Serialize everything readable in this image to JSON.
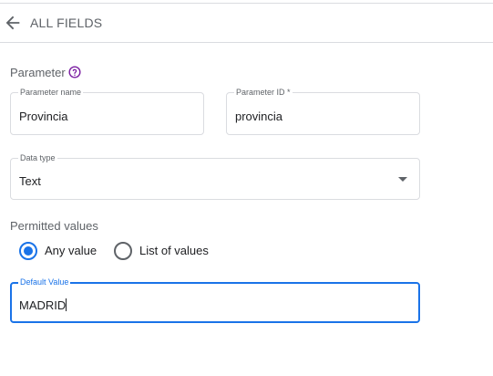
{
  "header": {
    "title": "ALL FIELDS",
    "back_icon": "arrow-left-icon"
  },
  "parameter": {
    "label": "Parameter",
    "help_icon": "help-circle-icon",
    "name_field": {
      "label": "Parameter name",
      "value": "Provincia"
    },
    "id_field": {
      "label": "Parameter ID *",
      "value": "provincia"
    },
    "data_type": {
      "label": "Data type",
      "value": "Text"
    }
  },
  "permitted": {
    "label": "Permitted values",
    "options": [
      {
        "label": "Any value",
        "selected": true
      },
      {
        "label": "List of values",
        "selected": false
      }
    ]
  },
  "default_value": {
    "label": "Default Value",
    "value": "MADRID"
  },
  "colors": {
    "accent": "#1a73e8",
    "help": "#7b1fa2",
    "border": "#dadce0"
  }
}
